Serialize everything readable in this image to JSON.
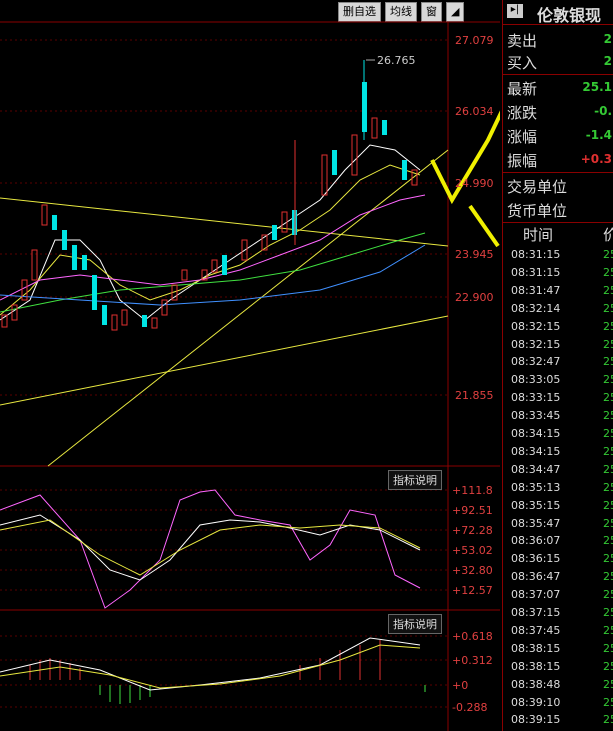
{
  "toolbar": {
    "buttons": [
      "删自选",
      "均线",
      "窗"
    ],
    "icon": "chart-icon"
  },
  "price_axis": {
    "labels": [
      "27.079",
      "26.034",
      "24.990",
      "23.945",
      "22.900",
      "21.855"
    ]
  },
  "kline": {
    "high_label": "26.765"
  },
  "panels": {
    "indicator1_title": "指标说明",
    "indicator1_labels": [
      "+111.8",
      "+92.51",
      "+72.28",
      "+53.02",
      "+32.80",
      "+12.57"
    ],
    "indicator2_title": "指标说明",
    "indicator2_labels": [
      "+0.618",
      "+0.312",
      "+0",
      "-0.288"
    ]
  },
  "right_panel": {
    "header_icon": "collapse-icon",
    "title": "伦敦银现",
    "rows": [
      {
        "label": "卖出",
        "value": "2"
      },
      {
        "label": "买入",
        "value": "2"
      },
      {
        "label": "最新",
        "value": "25.1"
      },
      {
        "label": "涨跌",
        "value": "-0."
      },
      {
        "label": "涨幅",
        "value": "-1.4"
      },
      {
        "label": "振幅",
        "value": "+0.3"
      },
      {
        "label": "交易单位",
        "value": ""
      },
      {
        "label": "货币单位",
        "value": ""
      }
    ],
    "tick_header_time": "时间",
    "tick_header_price": "价",
    "ticks": [
      {
        "time": "08:31:15",
        "price": "25"
      },
      {
        "time": "08:31:15",
        "price": "25"
      },
      {
        "time": "08:31:47",
        "price": "25"
      },
      {
        "time": "08:32:14",
        "price": "25"
      },
      {
        "time": "08:32:15",
        "price": "25"
      },
      {
        "time": "08:32:15",
        "price": "25"
      },
      {
        "time": "08:32:47",
        "price": "25"
      },
      {
        "time": "08:33:05",
        "price": "25"
      },
      {
        "time": "08:33:15",
        "price": "25"
      },
      {
        "time": "08:33:45",
        "price": "25"
      },
      {
        "time": "08:34:15",
        "price": "25"
      },
      {
        "time": "08:34:15",
        "price": "25"
      },
      {
        "time": "08:34:47",
        "price": "25"
      },
      {
        "time": "08:35:13",
        "price": "25"
      },
      {
        "time": "08:35:15",
        "price": "25"
      },
      {
        "time": "08:35:47",
        "price": "25"
      },
      {
        "time": "08:36:07",
        "price": "25"
      },
      {
        "time": "08:36:15",
        "price": "25"
      },
      {
        "time": "08:36:47",
        "price": "25"
      },
      {
        "time": "08:37:07",
        "price": "25"
      },
      {
        "time": "08:37:15",
        "price": "25"
      },
      {
        "time": "08:37:45",
        "price": "25"
      },
      {
        "time": "08:38:15",
        "price": "25"
      },
      {
        "time": "08:38:15",
        "price": "25"
      },
      {
        "time": "08:38:48",
        "price": "25"
      },
      {
        "time": "08:39:10",
        "price": "25"
      },
      {
        "time": "08:39:15",
        "price": "25"
      }
    ]
  },
  "colors": {
    "up": "#00e5e5",
    "down": "#e03030",
    "ma1": "#ffffff",
    "ma2": "#e8e840",
    "ma3": "#ff66ff",
    "ma4": "#40e040",
    "ma5": "#4090ff",
    "arrow": "#f0f000",
    "tick_price": "#34c934"
  }
}
